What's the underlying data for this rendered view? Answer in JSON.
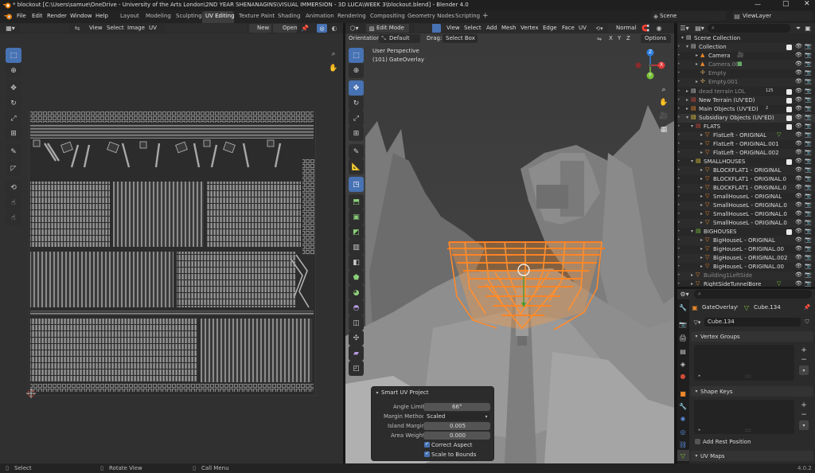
{
  "title_bar": {
    "text": "* blockout [C:\\Users\\samue\\OneDrive - University of the Arts London\\2ND YEAR SHENANAGINS\\VISUAL IMMERSION - 3D LUCA\\WEEK 3\\blockout.blend] - Blender 4.0"
  },
  "menu": [
    "File",
    "Edit",
    "Render",
    "Window",
    "Help"
  ],
  "workspaces": [
    "Layout",
    "Modeling",
    "Sculpting",
    "UV Editing",
    "Texture Paint",
    "Shading",
    "Animation",
    "Rendering",
    "Compositing",
    "Geometry Nodes",
    "Scripting"
  ],
  "workspace_add": "+",
  "scene": {
    "label": "Scene",
    "view_layer": "ViewLayer"
  },
  "uv_editor": {
    "menus": [
      "View",
      "Select",
      "Image",
      "UV"
    ],
    "new_label": "New",
    "open_label": "Open"
  },
  "viewport": {
    "mode": "Edit Mode",
    "menus": [
      "View",
      "Select",
      "Add",
      "Mesh",
      "Vertex",
      "Edge",
      "Face",
      "UV"
    ],
    "shading_label": "Normal",
    "orientation_label": "Orientation:",
    "orientation_value": "Default",
    "drag_label": "Drag:",
    "drag_value": "Select Box",
    "axes": [
      "X",
      "Y",
      "Z"
    ],
    "options_label": "Options",
    "info_line1": "User Perspective",
    "info_line2": "(101) GateOverlay",
    "gizmo_axes": [
      "X",
      "Y",
      "Z"
    ]
  },
  "operator_panel": {
    "title": "Smart UV Project",
    "angle_limit_label": "Angle Limit",
    "angle_limit_value": "66°",
    "margin_method_label": "Margin Method",
    "margin_method_value": "Scaled",
    "island_margin_label": "Island Margin",
    "island_margin_value": "0.005",
    "area_weight_label": "Area Weight",
    "area_weight_value": "0.000",
    "correct_aspect_label": "Correct Aspect",
    "scale_to_bounds_label": "Scale to Bounds"
  },
  "outliner": {
    "items": [
      {
        "label": "Scene Collection"
      },
      {
        "label": "Collection"
      },
      {
        "label": "Camera"
      },
      {
        "label": "Camera.001"
      },
      {
        "label": "Empty"
      },
      {
        "label": "Empty.001"
      },
      {
        "label": "dead terrain LOL"
      },
      {
        "label": "New Terrain (UV'ED)"
      },
      {
        "label": "Main Objects (UV'ED)"
      },
      {
        "label": "Subsidiary Objects (UV'ED)"
      },
      {
        "label": "FLATS"
      },
      {
        "label": "FlatLeft - ORIGINAL"
      },
      {
        "label": "FlatLeft - ORIGINAL.001"
      },
      {
        "label": "FlatLeft - ORIGINAL.002"
      },
      {
        "label": "SMALLHOUSES"
      },
      {
        "label": "BLOCKFLAT1 - ORIGINAL"
      },
      {
        "label": "BLOCKFLAT1 - ORIGINAL.0"
      },
      {
        "label": "BLOCKFLAT1 - ORIGINAL.0"
      },
      {
        "label": "SmallHouseL - ORIGINAL"
      },
      {
        "label": "SmallHouseL - ORIGINAL.0"
      },
      {
        "label": "SmallHouseL - ORIGINAL.0"
      },
      {
        "label": "SmallHouseL - ORIGINAL.0"
      },
      {
        "label": "BIGHOUSES"
      },
      {
        "label": "BigHouseL - ORIGINAL"
      },
      {
        "label": "BigHouseL - ORIGINAL.00"
      },
      {
        "label": "BigHouseL - ORIGINAL.002"
      },
      {
        "label": "BigHouseL - ORIGINAL.00"
      },
      {
        "label": "Building1LeftSide"
      },
      {
        "label": "RightSideTunnelBore"
      }
    ],
    "badges": [
      "125",
      "2"
    ]
  },
  "properties": {
    "breadcrumb_object": "GateOverlay",
    "breadcrumb_data": "Cube.134",
    "data_name": "Cube.134",
    "vertex_groups_label": "Vertex Groups",
    "shape_keys_label": "Shape Keys",
    "add_rest_position_label": "Add Rest Position",
    "uv_maps_label": "UV Maps"
  },
  "status_bar": {
    "select": "Select",
    "rotate_view": "Rotate View",
    "call_menu": "Call Menu",
    "version": "4.0.2"
  },
  "colors": {
    "accent": "#4772b3",
    "orange_selection": "#ff7a1a",
    "collection_header": "#3d3d3d"
  }
}
